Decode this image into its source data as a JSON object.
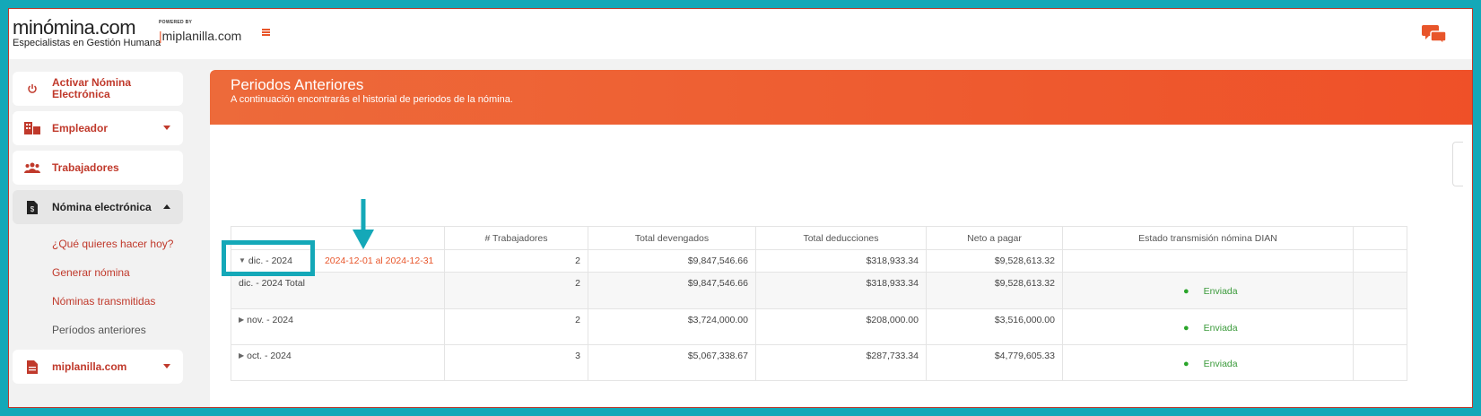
{
  "brand": {
    "logo_text": "minómina.com",
    "logo_tagline": "Especialistas en Gestión Humana",
    "powered_by": "POWERED BY",
    "partner": "miplanilla.com"
  },
  "sidebar": {
    "items": [
      {
        "label": "Activar Nómina Electrónica",
        "icon": "power-icon"
      },
      {
        "label": "Empleador",
        "icon": "building-icon"
      },
      {
        "label": "Trabajadores",
        "icon": "users-icon"
      },
      {
        "label": "Nómina electrónica",
        "icon": "invoice-icon"
      },
      {
        "label": "miplanilla.com",
        "icon": "document-icon"
      }
    ],
    "subitems": [
      "¿Qué quieres hacer hoy?",
      "Generar nómina",
      "Nóminas transmitidas",
      "Períodos anteriores"
    ]
  },
  "banner": {
    "title": "Periodos Anteriores",
    "subtitle": "A continuación encontrarás el historial de periodos de la nómina."
  },
  "table": {
    "headers": [
      "",
      "# Trabajadores",
      "Total devengados",
      "Total deducciones",
      "Neto a pagar",
      "Estado transmisión nómina DIAN"
    ],
    "rows": [
      {
        "period": "dic. - 2024",
        "range": "2024-12-01 al 2024-12-31",
        "workers": "2",
        "devengados": "$9,847,546.66",
        "deducciones": "$318,933.34",
        "neto": "$9,528,613.32",
        "status": ""
      },
      {
        "period": "dic. - 2024 Total",
        "workers": "2",
        "devengados": "$9,847,546.66",
        "deducciones": "$318,933.34",
        "neto": "$9,528,613.32",
        "status": "Enviada"
      },
      {
        "period": "nov. - 2024",
        "workers": "2",
        "devengados": "$3,724,000.00",
        "deducciones": "$208,000.00",
        "neto": "$3,516,000.00",
        "status": "Enviada"
      },
      {
        "period": "oct. - 2024",
        "workers": "3",
        "devengados": "$5,067,338.67",
        "deducciones": "$287,733.34",
        "neto": "$4,779,605.33",
        "status": "Enviada"
      }
    ]
  },
  "colors": {
    "accent": "#ef5a2b",
    "annotation": "#14a8b8",
    "status_ok": "#2aa52a"
  }
}
